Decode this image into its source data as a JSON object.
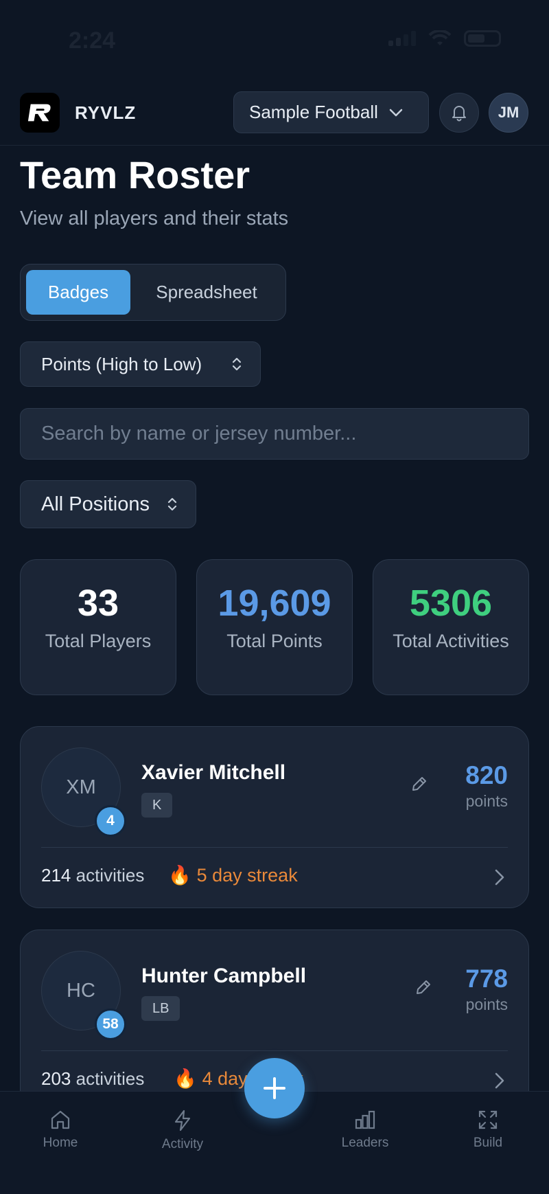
{
  "status_bar": {
    "time": "2:24"
  },
  "header": {
    "brand": "RYVLZ",
    "team_select": "Sample Football",
    "avatar_initials": "JM"
  },
  "page": {
    "title": "Team Roster",
    "subtitle": "View all players and their stats"
  },
  "view_toggle": {
    "badges": "Badges",
    "spreadsheet": "Spreadsheet",
    "active": "badges"
  },
  "sort": {
    "selected": "Points (High to Low)"
  },
  "search": {
    "placeholder": "Search by name or jersey number..."
  },
  "position_filter": {
    "selected": "All Positions"
  },
  "stats": [
    {
      "value": "33",
      "label": "Total Players",
      "color": "#ffffff"
    },
    {
      "value": "19,609",
      "label": "Total Points",
      "color": "#5b9ae6"
    },
    {
      "value": "5306",
      "label": "Total Activities",
      "color": "#3fcf7f"
    }
  ],
  "players": [
    {
      "initials": "XM",
      "jersey": "4",
      "name": "Xavier Mitchell",
      "position": "K",
      "points": "820",
      "points_label": "points",
      "activities_count": "214",
      "activities_label": "activities",
      "streak": "5 day streak"
    },
    {
      "initials": "HC",
      "jersey": "58",
      "name": "Hunter Campbell",
      "position": "LB",
      "points": "778",
      "points_label": "points",
      "activities_count": "203",
      "activities_label": "activities",
      "streak": "4 day streak"
    }
  ],
  "nav": {
    "home": "Home",
    "activity": "Activity",
    "leaders": "Leaders",
    "build": "Build"
  },
  "colors": {
    "accent": "#4a9ee0",
    "streak": "#e9893a",
    "background": "#0d1624"
  }
}
